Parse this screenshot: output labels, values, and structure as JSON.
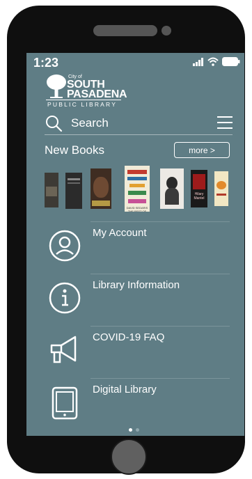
{
  "status_bar": {
    "time": "1:23",
    "icons": [
      "signal-icon",
      "wifi-icon",
      "battery-icon"
    ]
  },
  "logo": {
    "city_of": "City of",
    "line1": "SOUTH",
    "line2": "PASADENA",
    "subtitle": "PUBLIC LIBRARY"
  },
  "search": {
    "placeholder": "Search"
  },
  "new_books": {
    "title": "New Books",
    "more_label": "more >",
    "book_covers": [
      {
        "color": "#3d3a35",
        "title": ""
      },
      {
        "color": "#2b2b2b",
        "title": ""
      },
      {
        "color": "#3f2d22",
        "title": ""
      },
      {
        "color": "#f1ebd8",
        "title": "DAVID SEDARIS THE BEST OF ME"
      },
      {
        "color": "#ece9e4",
        "title": ""
      },
      {
        "color": "#1a1a1a",
        "title": "Hilary Mantel"
      },
      {
        "color": "#f2e7c3",
        "title": ""
      }
    ]
  },
  "menu": {
    "items": [
      {
        "label": "My Account",
        "icon": "user-icon"
      },
      {
        "label": "Library Information",
        "icon": "info-icon"
      },
      {
        "label": "COVID-19 FAQ",
        "icon": "megaphone-icon"
      },
      {
        "label": "Digital Library",
        "icon": "tablet-icon"
      }
    ]
  },
  "pagination": {
    "total": 2,
    "active": 1
  },
  "colors": {
    "screen_bg": "#5f7d85",
    "phone_body": "#0f0f0f",
    "text": "#ffffff"
  }
}
